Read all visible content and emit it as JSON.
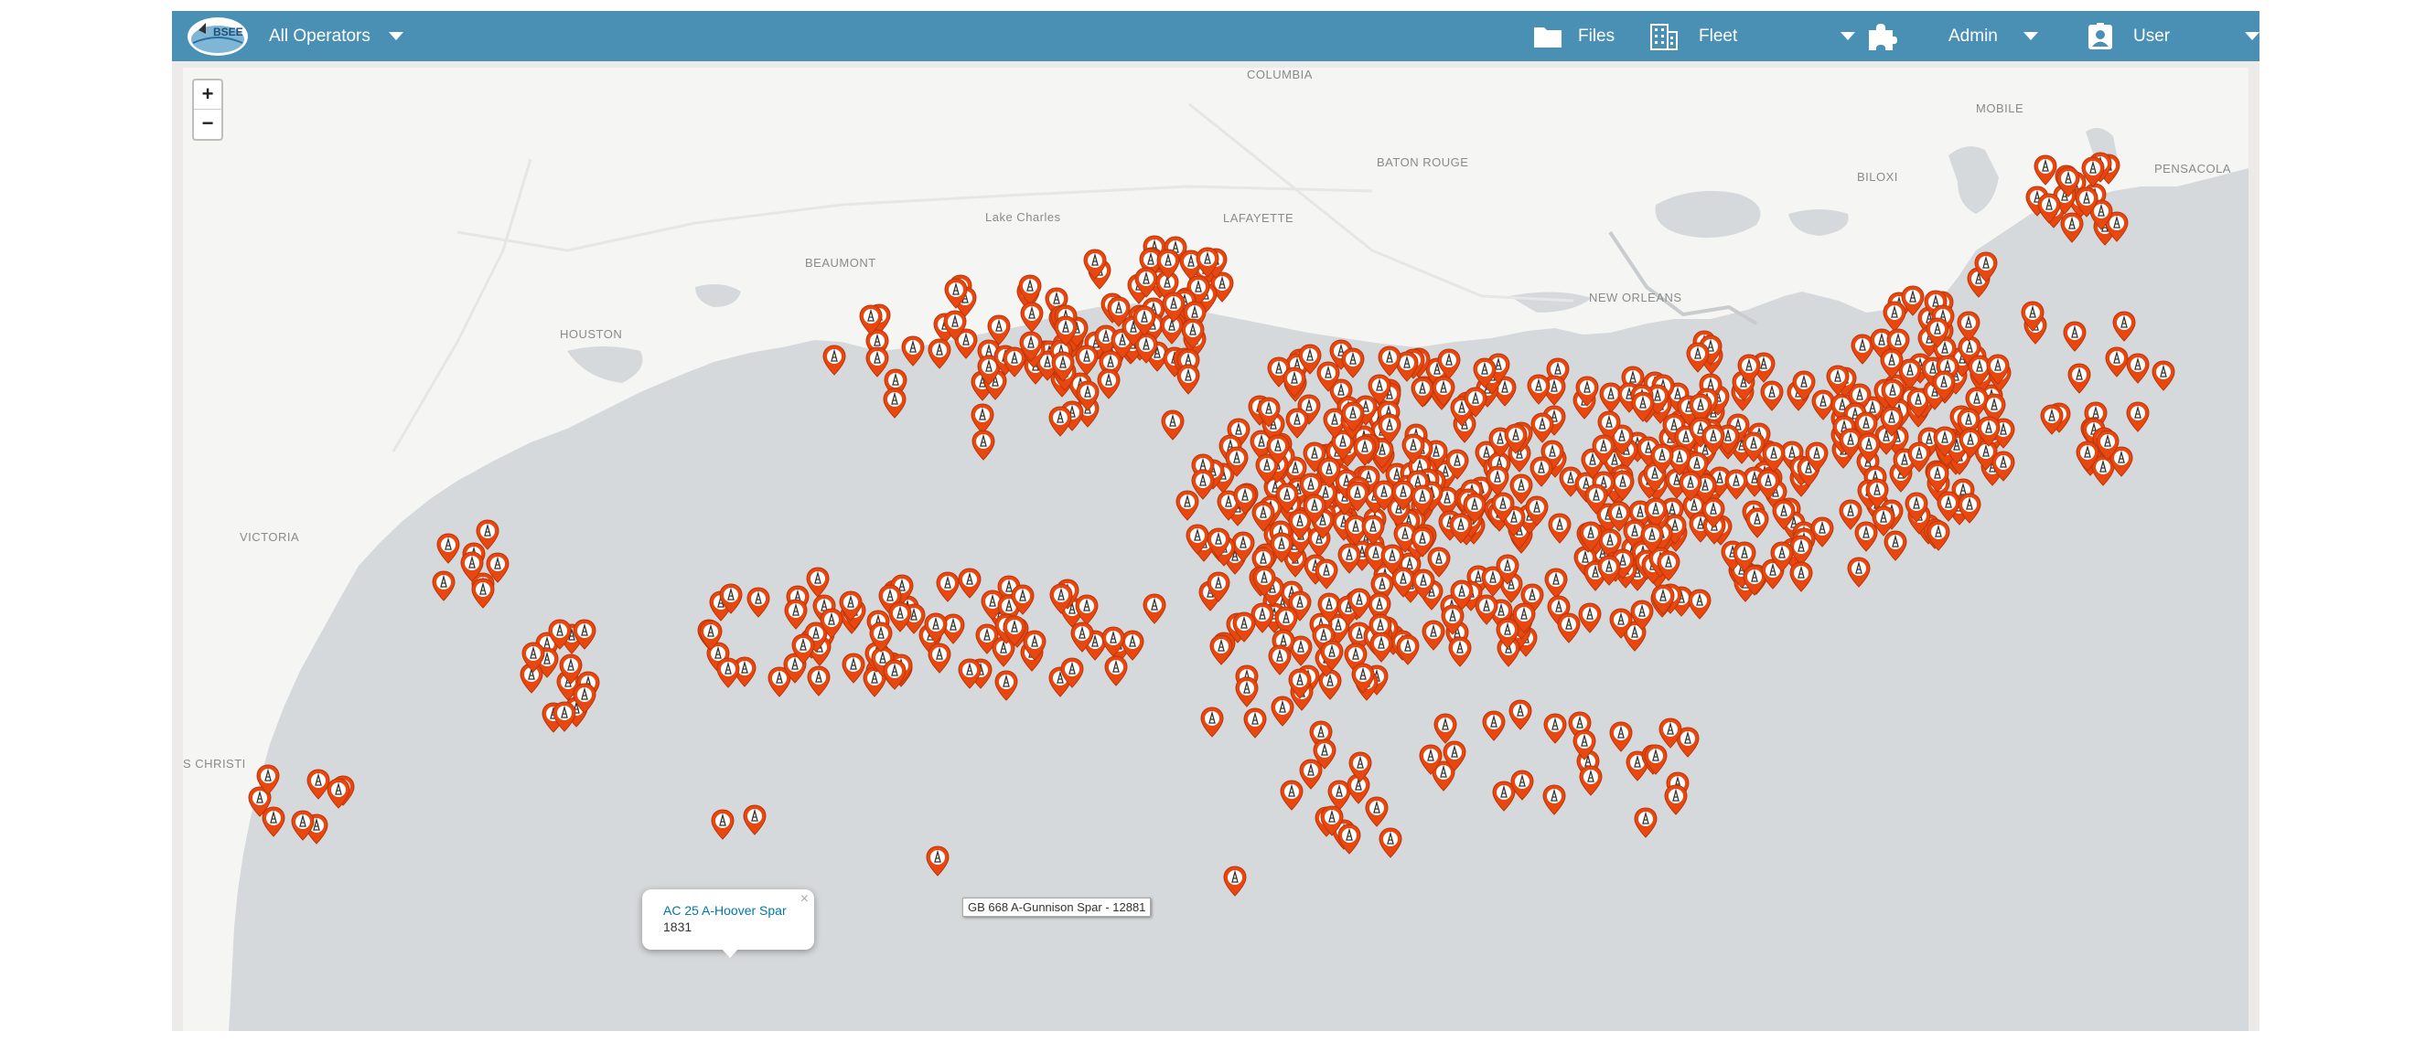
{
  "navbar": {
    "logo_text": "BSEE",
    "operator_select": "All Operators",
    "files_label": "Files",
    "fleet_label": "Fleet",
    "admin_label": "Admin",
    "user_label": "User",
    "icons": [
      "folder-icon",
      "building-icon",
      "puzzle-icon",
      "user-badge-icon"
    ],
    "bar_color": "#4a90b4"
  },
  "map": {
    "zoom_in": "+",
    "zoom_out": "−",
    "cities": [
      "HOUSTON",
      "BEAUMONT",
      "Lake Charles",
      "LAFAYETTE",
      "BATON ROUGE",
      "NEW ORLEANS",
      "BILOXI",
      "MOBILE",
      "PENSACOLA",
      "VICTORIA",
      "S CHRISTI",
      "COLUMBIA"
    ],
    "marker_color": "#e8470f",
    "marker_icon": "oil-platform-icon",
    "water_color": "#d6d9db",
    "land_color": "#f5f5f4"
  },
  "popup": {
    "link": "AC 25 A-Hoover Spar",
    "number": "1831",
    "close": "×"
  },
  "tooltip": {
    "text": "GB 668 A-Gunnison Spar  - 12881"
  }
}
